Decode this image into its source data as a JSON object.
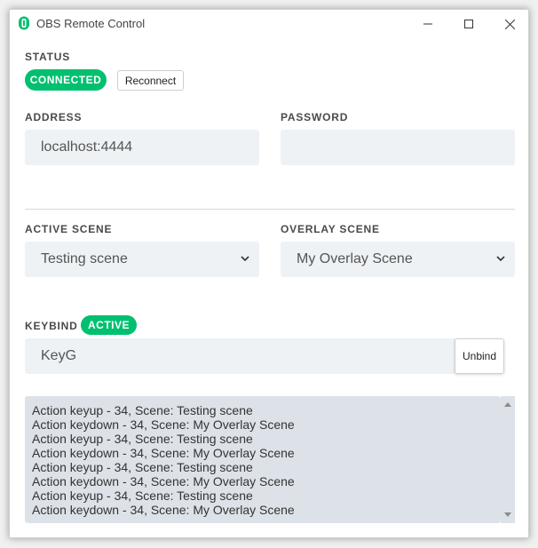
{
  "window": {
    "title": "OBS Remote Control"
  },
  "status": {
    "label": "STATUS",
    "state": "CONNECTED",
    "reconnect_label": "Reconnect"
  },
  "address": {
    "label": "ADDRESS",
    "value": "localhost:4444"
  },
  "password": {
    "label": "PASSWORD",
    "value": ""
  },
  "active_scene": {
    "label": "ACTIVE SCENE",
    "selected": "Testing scene"
  },
  "overlay_scene": {
    "label": "OVERLAY SCENE",
    "selected": "My Overlay Scene"
  },
  "keybind": {
    "label": "KEYBIND",
    "badge": "ACTIVE",
    "value": "KeyG",
    "unbind_label": "Unbind"
  },
  "log": {
    "lines": [
      "Action keyup - 34, Scene: Testing scene",
      "Action keydown - 34, Scene: My Overlay Scene",
      "Action keyup - 34, Scene: Testing scene",
      "Action keydown - 34, Scene: My Overlay Scene",
      "Action keyup - 34, Scene: Testing scene",
      "Action keydown - 34, Scene: My Overlay Scene",
      "Action keyup - 34, Scene: Testing scene",
      "Action keydown - 34, Scene: My Overlay Scene"
    ]
  },
  "colors": {
    "accent": "#00c070",
    "field_bg": "#eef2f5",
    "log_bg": "#dde2e8"
  }
}
